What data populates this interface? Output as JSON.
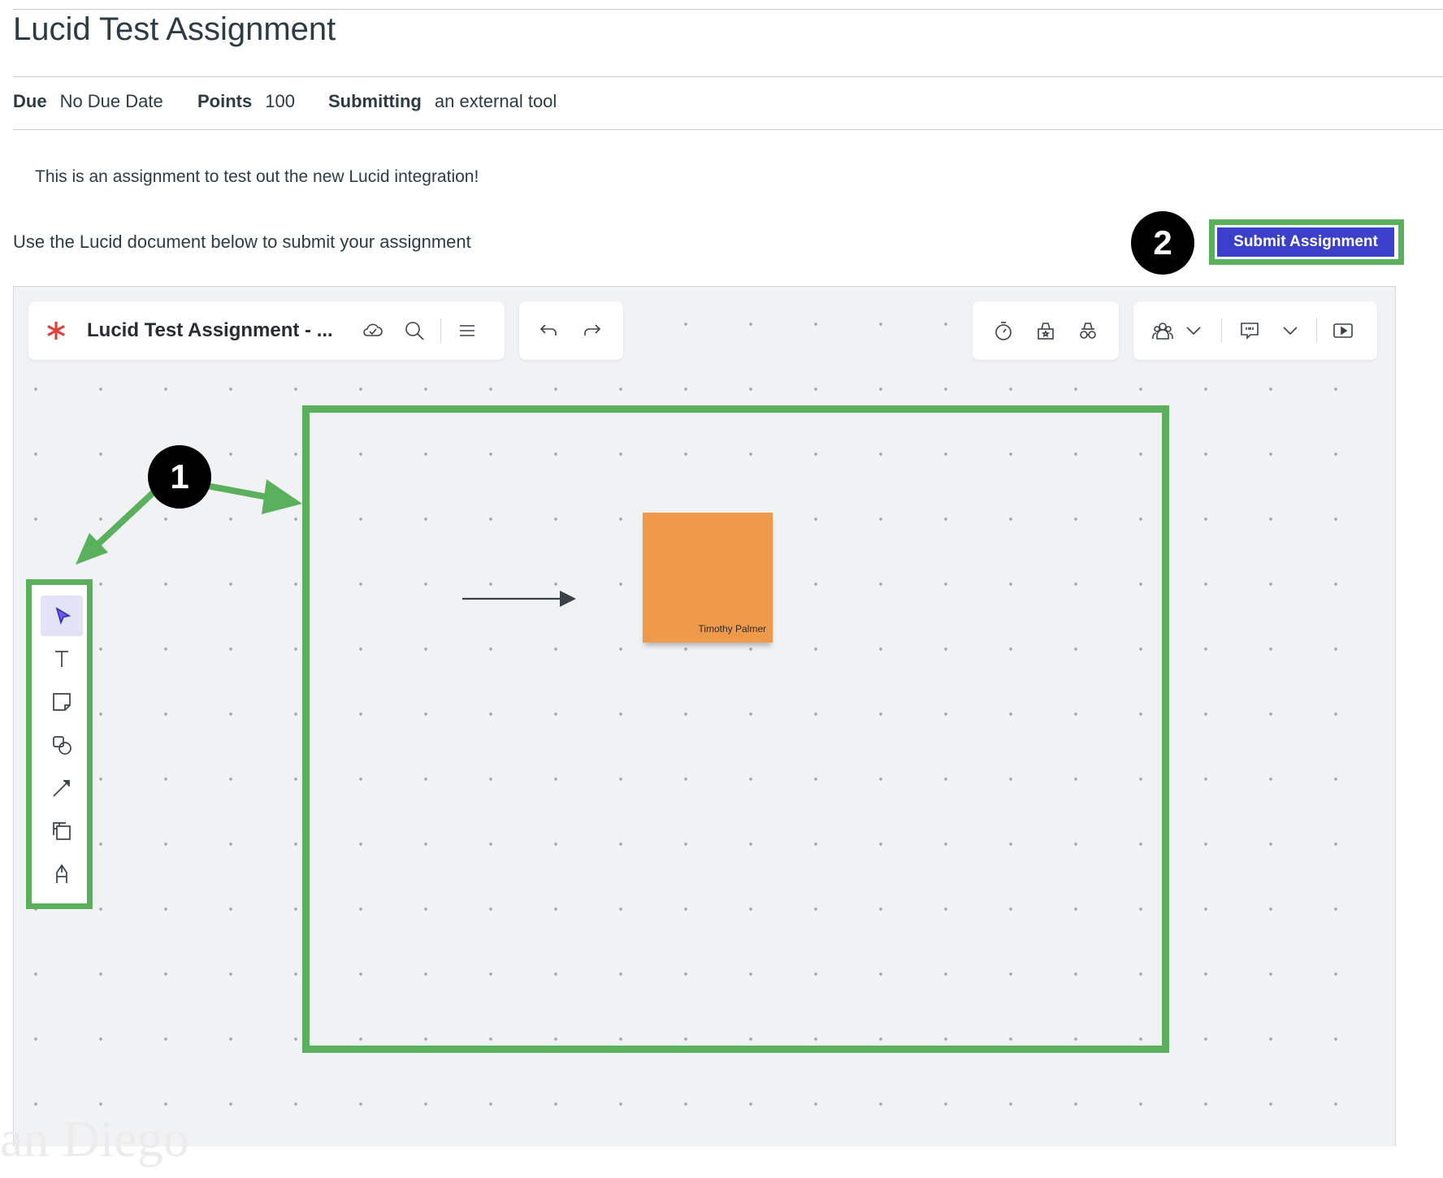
{
  "page": {
    "title": "Lucid Test Assignment",
    "due_label": "Due",
    "due_value": "No Due Date",
    "points_label": "Points",
    "points_value": "100",
    "submitting_label": "Submitting",
    "submitting_value": "an external tool",
    "description": "This is an assignment to test out the new Lucid integration!",
    "instructions": "Use the Lucid document below to submit your assignment",
    "submit_button": "Submit Assignment"
  },
  "lucid": {
    "document_title": "Lucid Test Assignment - ...",
    "top_icons": [
      "lucid-logo-icon",
      "cloud-saved-icon",
      "search-icon",
      "menu-icon",
      "undo-icon",
      "redo-icon",
      "timer-icon",
      "voting-icon",
      "private-mode-icon",
      "collaborators-icon",
      "chevron-down-icon",
      "comments-icon",
      "chevron-down-icon",
      "present-icon"
    ],
    "tools": [
      "select-tool-icon",
      "text-tool-icon",
      "sticky-note-tool-icon",
      "shapes-tool-icon",
      "line-tool-icon",
      "frame-tool-icon",
      "pen-tool-icon"
    ],
    "sticky_note_author": "Timothy Palmer",
    "sticky_note_color": "#EE9A4A"
  },
  "annotations": {
    "badge_1": "1",
    "badge_2": "2",
    "highlight_color": "#5BB05E"
  },
  "watermark": "an Diego"
}
